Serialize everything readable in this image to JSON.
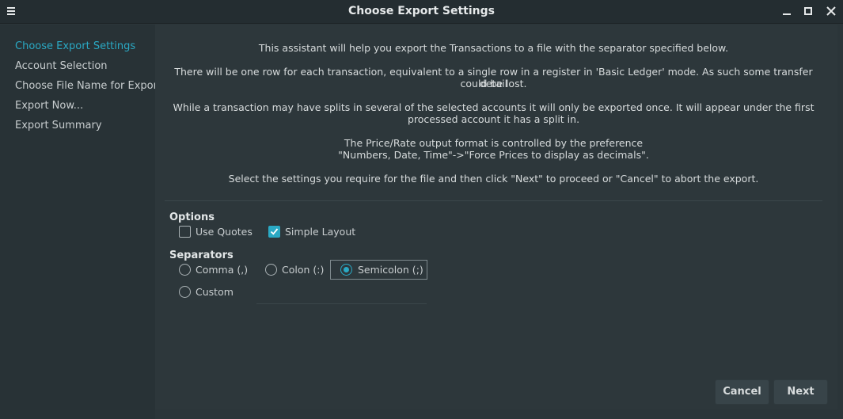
{
  "window": {
    "title": "Choose Export Settings"
  },
  "sidebar": {
    "items": [
      {
        "label": "Choose Export Settings",
        "active": true
      },
      {
        "label": "Account Selection",
        "active": false
      },
      {
        "label": "Choose File Name for Export",
        "active": false
      },
      {
        "label": "Export Now...",
        "active": false
      },
      {
        "label": "Export Summary",
        "active": false
      }
    ]
  },
  "intro": {
    "p1": "This assistant will help you export the Transactions to a file with the separator specified below.",
    "p2_line1": "There will be one row for each transaction, equivalent to a single row in a register in 'Basic Ledger' mode. As such some transfer detail",
    "p2_line2": "could be lost.",
    "p3_line1": "While a transaction may have splits in several of the selected accounts it will only be exported once. It will appear under the first",
    "p3_line2": "processed account it has a split in.",
    "p4_line1": "The Price/Rate output format is controlled by the preference",
    "p4_line2": "\"Numbers, Date, Time\"->\"Force Prices to display as decimals\".",
    "p5": "Select the settings you require for the file and then click \"Next\" to proceed or \"Cancel\" to abort the export."
  },
  "options": {
    "label": "Options",
    "use_quotes": {
      "label": "Use Quotes",
      "checked": false
    },
    "simple_layout": {
      "label": "Simple Layout",
      "checked": true
    }
  },
  "separators": {
    "label": "Separators",
    "comma": {
      "label": "Comma (,)",
      "selected": false
    },
    "colon": {
      "label": "Colon (:)",
      "selected": false
    },
    "semicolon": {
      "label": "Semicolon (;)",
      "selected": true
    },
    "custom": {
      "label": "Custom",
      "selected": false
    }
  },
  "buttons": {
    "cancel": "Cancel",
    "next": "Next"
  },
  "colors": {
    "accent": "#2aa9c4",
    "background": "#2b3539"
  }
}
